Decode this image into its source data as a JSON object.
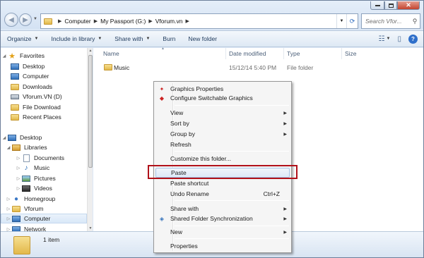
{
  "address": {
    "crumbs": [
      "Computer",
      "My Passport (G:)",
      "Vforum.vn"
    ]
  },
  "search": {
    "placeholder": "Search Vfor..."
  },
  "toolbar": {
    "organize": "Organize",
    "include": "Include in library",
    "share": "Share with",
    "burn": "Burn",
    "new_folder": "New folder"
  },
  "nav": {
    "favorites": "Favorites",
    "desktop_fav": "Desktop",
    "computer_fav": "Computer",
    "downloads": "Downloads",
    "vforum_d": "Vforum.VN (D)",
    "file_download": "File Download",
    "recent": "Recent Places",
    "desktop": "Desktop",
    "libraries": "Libraries",
    "documents": "Documents",
    "music": "Music",
    "pictures": "Pictures",
    "videos": "Videos",
    "homegroup": "Homegroup",
    "vforum": "Vforum",
    "computer": "Computer",
    "network": "Network"
  },
  "columns": {
    "name": "Name",
    "date": "Date modified",
    "type": "Type",
    "size": "Size"
  },
  "files": [
    {
      "name": "Music",
      "date": "15/12/14 5:40 PM",
      "type": "File folder",
      "size": ""
    }
  ],
  "context_menu": {
    "graphics_properties": "Graphics Properties",
    "configure_graphics": "Configure Switchable Graphics",
    "view": "View",
    "sort_by": "Sort by",
    "group_by": "Group by",
    "refresh": "Refresh",
    "customize": "Customize this folder...",
    "paste": "Paste",
    "paste_shortcut": "Paste shortcut",
    "undo_rename": "Undo Rename",
    "undo_shortcut": "Ctrl+Z",
    "share_with": "Share with",
    "shared_sync": "Shared Folder Synchronization",
    "new": "New",
    "properties": "Properties"
  },
  "details": {
    "count": "1 item"
  },
  "colors": {
    "highlight_box": "#b0111a",
    "window_frame": "#dce8f6"
  }
}
